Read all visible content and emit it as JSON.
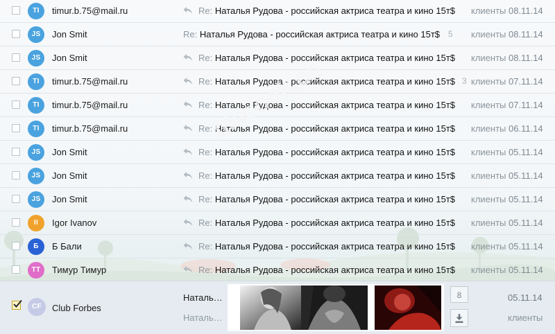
{
  "colors": {
    "avatar_blue": "#4aa3df",
    "avatar_orange": "#f0a22c",
    "avatar_deepblue": "#2a62d6",
    "avatar_pink": "#e06ec9",
    "avatar_lavender": "#c5cbe6"
  },
  "rows": [
    {
      "initials": "TI",
      "avatar_color": "#4aa3df",
      "sender": "timur.b.75@mail.ru",
      "re": "Re:",
      "subject": "Наталья Рудова - российская актриса театра и кино 15т$",
      "count": "",
      "folder": "клиенты",
      "date": "08.11.14",
      "has_reply": true
    },
    {
      "initials": "JS",
      "avatar_color": "#4aa3df",
      "sender": "Jon Smit",
      "re": "Re:",
      "subject": "Наталья Рудова - российская актриса театра и кино 15т$",
      "count": "5",
      "folder": "клиенты",
      "date": "08.11.14",
      "has_reply": false
    },
    {
      "initials": "JS",
      "avatar_color": "#4aa3df",
      "sender": "Jon Smit",
      "re": "Re:",
      "subject": "Наталья Рудова - российская актриса театра и кино 15т$",
      "count": "",
      "folder": "клиенты",
      "date": "08.11.14",
      "has_reply": true
    },
    {
      "initials": "TI",
      "avatar_color": "#4aa3df",
      "sender": "timur.b.75@mail.ru",
      "re": "Re:",
      "subject": "Наталья Рудова - российская актриса театра и кино 15т$",
      "count": "3",
      "folder": "клиенты",
      "date": "07.11.14",
      "has_reply": true
    },
    {
      "initials": "TI",
      "avatar_color": "#4aa3df",
      "sender": "timur.b.75@mail.ru",
      "re": "Re:",
      "subject": "Наталья Рудова - российская актриса театра и кино 15т$",
      "count": "",
      "folder": "клиенты",
      "date": "07.11.14",
      "has_reply": true
    },
    {
      "initials": "TI",
      "avatar_color": "#4aa3df",
      "sender": "timur.b.75@mail.ru",
      "re": "Re:",
      "subject": "Наталья Рудова - российская актриса театра и кино 15т$",
      "count": "",
      "folder": "клиенты",
      "date": "06.11.14",
      "has_reply": true
    },
    {
      "initials": "JS",
      "avatar_color": "#4aa3df",
      "sender": "Jon Smit",
      "re": "Re:",
      "subject": "Наталья Рудова - российская актриса театра и кино 15т$",
      "count": "",
      "folder": "клиенты",
      "date": "05.11.14",
      "has_reply": true
    },
    {
      "initials": "JS",
      "avatar_color": "#4aa3df",
      "sender": "Jon Smit",
      "re": "Re:",
      "subject": "Наталья Рудова - российская актриса театра и кино 15т$",
      "count": "",
      "folder": "клиенты",
      "date": "05.11.14",
      "has_reply": true
    },
    {
      "initials": "JS",
      "avatar_color": "#4aa3df",
      "sender": "Jon Smit",
      "re": "Re:",
      "subject": "Наталья Рудова - российская актриса театра и кино 15т$",
      "count": "",
      "folder": "клиенты",
      "date": "05.11.14",
      "has_reply": true
    },
    {
      "initials": "II",
      "avatar_color": "#f0a22c",
      "sender": "Igor Ivanov",
      "re": "Re:",
      "subject": "Наталья Рудова - российская актриса театра и кино 15т$",
      "count": "",
      "folder": "клиенты",
      "date": "05.11.14",
      "has_reply": true
    },
    {
      "initials": "Б",
      "avatar_color": "#2a62d6",
      "sender": "Б Бали",
      "re": "Re:",
      "subject": "Наталья Рудова - российская актриса театра и кино 15т$",
      "count": "",
      "folder": "клиенты",
      "date": "05.11.14",
      "has_reply": true
    },
    {
      "initials": "TT",
      "avatar_color": "#e06ec9",
      "sender": "Тимур Тимур",
      "re": "Re:",
      "subject": "Наталья Рудова - российская актриса театра и кино 15т$",
      "count": "",
      "folder": "клиенты",
      "date": "05.11.14",
      "has_reply": true
    }
  ],
  "selected": {
    "initials": "CF",
    "avatar_color": "#c5cbe6",
    "sender": "Club Forbes",
    "subject_line": "Наталья Рудова",
    "snippet_line": "Наталья Рудова",
    "attachment_count": "8",
    "date": "05.11.14",
    "folder": "клиенты",
    "download_icon": "download-icon"
  },
  "watermark": "filecook.ch"
}
